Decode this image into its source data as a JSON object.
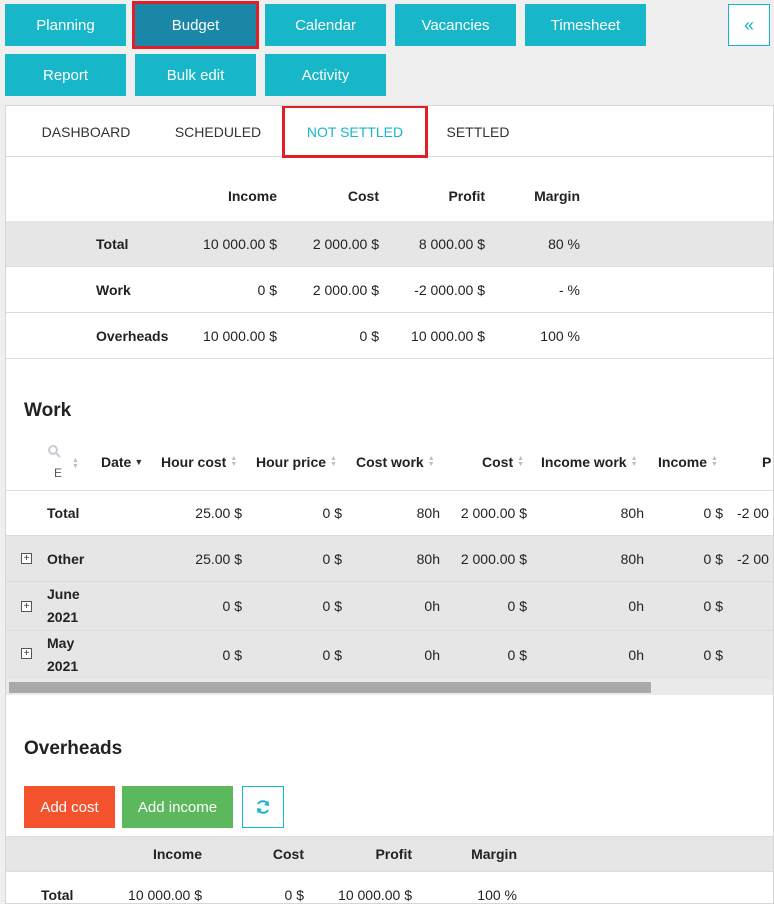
{
  "nav": {
    "planning": "Planning",
    "budget": "Budget",
    "calendar": "Calendar",
    "vacancies": "Vacancies",
    "timesheet": "Timesheet",
    "report": "Report",
    "bulk_edit": "Bulk edit",
    "activity": "Activity",
    "collapse": "«"
  },
  "tabs": {
    "dashboard": "DASHBOARD",
    "scheduled": "SCHEDULED",
    "not_settled": "NOT SETTLED",
    "settled": "SETTLED"
  },
  "summary": {
    "headers": {
      "income": "Income",
      "cost": "Cost",
      "profit": "Profit",
      "margin": "Margin"
    },
    "rows": [
      {
        "label": "Total",
        "income": "10 000.00 $",
        "cost": "2 000.00 $",
        "profit": "8 000.00 $",
        "margin": "80 %"
      },
      {
        "label": "Work",
        "income": "0 $",
        "cost": "2 000.00 $",
        "profit": "-2 000.00 $",
        "margin": "- %"
      },
      {
        "label": "Overheads",
        "income": "10 000.00 $",
        "cost": "0 $",
        "profit": "10 000.00 $",
        "margin": "100 %"
      }
    ]
  },
  "work": {
    "title": "Work",
    "headers": {
      "filter_letter": "E",
      "date": "Date",
      "hour_cost": "Hour cost",
      "hour_price": "Hour price",
      "cost_work": "Cost work",
      "cost": "Cost",
      "income_work": "Income work",
      "income": "Income",
      "profit_partial": "P"
    },
    "rows": [
      {
        "label": "Total",
        "label2": "",
        "hour_cost": "25.00 $",
        "hour_price": "0 $",
        "cost_work": "80h",
        "cost": "2 000.00 $",
        "income_work": "80h",
        "income": "0 $",
        "profit": "-2 00"
      },
      {
        "label": "Other",
        "label2": "",
        "hour_cost": "25.00 $",
        "hour_price": "0 $",
        "cost_work": "80h",
        "cost": "2 000.00 $",
        "income_work": "80h",
        "income": "0 $",
        "profit": "-2 00"
      },
      {
        "label": "June",
        "label2": "2021",
        "hour_cost": "0 $",
        "hour_price": "0 $",
        "cost_work": "0h",
        "cost": "0 $",
        "income_work": "0h",
        "income": "0 $",
        "profit": ""
      },
      {
        "label": "May",
        "label2": "2021",
        "hour_cost": "0 $",
        "hour_price": "0 $",
        "cost_work": "0h",
        "cost": "0 $",
        "income_work": "0h",
        "income": "0 $",
        "profit": ""
      }
    ]
  },
  "overheads": {
    "title": "Overheads",
    "add_cost": "Add cost",
    "add_income": "Add income",
    "headers": {
      "income": "Income",
      "cost": "Cost",
      "profit": "Profit",
      "margin": "Margin"
    },
    "rows": [
      {
        "label": "Total",
        "income": "10 000.00 $",
        "cost": "0 $",
        "profit": "10 000.00 $",
        "margin": "100 %"
      }
    ]
  },
  "colors": {
    "accent": "#17b6c9",
    "active_nav": "#1a87a8",
    "highlight": "#e01f26",
    "add_cost": "#f4522d",
    "add_income": "#5cb85c"
  }
}
